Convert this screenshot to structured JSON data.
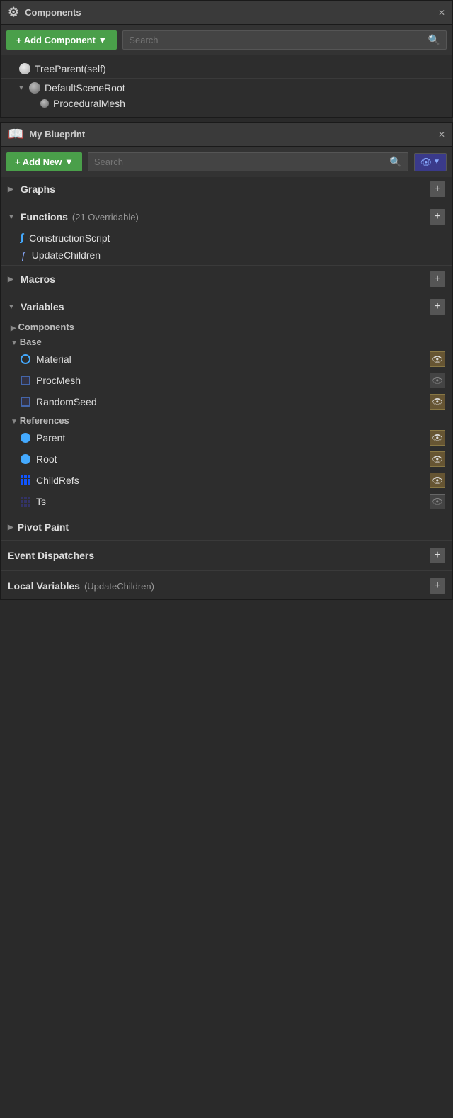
{
  "components_panel": {
    "title": "Components",
    "add_button": "+ Add Component ▼",
    "search_placeholder": "Search",
    "tree": [
      {
        "label": "TreeParent(self)",
        "indent": 0,
        "icon": "sphere",
        "arrow": ""
      },
      {
        "label": "DefaultSceneRoot",
        "indent": 1,
        "icon": "gear-sphere",
        "arrow": "▼"
      },
      {
        "label": "ProceduralMesh",
        "indent": 2,
        "icon": "gear-sphere-small",
        "arrow": ""
      }
    ]
  },
  "blueprint_panel": {
    "title": "My Blueprint",
    "add_button": "+ Add New ▼",
    "search_placeholder": "Search",
    "sections": {
      "graphs": {
        "label": "Graphs",
        "expanded": false
      },
      "functions": {
        "label": "Functions",
        "subtitle": "(21 Overridable)",
        "expanded": true
      },
      "macros": {
        "label": "Macros",
        "expanded": false
      },
      "variables": {
        "label": "Variables",
        "expanded": true
      },
      "pivot_paint": {
        "label": "Pivot Paint",
        "expanded": false
      },
      "event_dispatchers": {
        "label": "Event Dispatchers"
      },
      "local_variables": {
        "label": "Local Variables",
        "subtitle": "(UpdateChildren)"
      }
    },
    "functions": [
      {
        "label": "ConstructionScript",
        "type": "cs"
      },
      {
        "label": "UpdateChildren",
        "type": "f"
      }
    ],
    "variable_groups": {
      "components": {
        "label": "Components"
      },
      "base": {
        "label": "Base",
        "items": [
          {
            "label": "Material",
            "dot": "blue-outline",
            "eye": true
          },
          {
            "label": "ProcMesh",
            "dot": "dark-blue",
            "eye": false
          },
          {
            "label": "RandomSeed",
            "dot": "dark-blue",
            "eye": true
          }
        ]
      },
      "references": {
        "label": "References",
        "items": [
          {
            "label": "Parent",
            "dot": "blue-fill",
            "eye": true
          },
          {
            "label": "Root",
            "dot": "blue-fill",
            "eye": true
          },
          {
            "label": "ChildRefs",
            "dot": "grid",
            "eye": true
          },
          {
            "label": "Ts",
            "dot": "grid-dark",
            "eye": false
          }
        ]
      }
    }
  },
  "icons": {
    "close": "✕",
    "search": "🔍",
    "eye": "👁",
    "arrow_down": "▼",
    "arrow_right": "▶",
    "plus": "+"
  }
}
